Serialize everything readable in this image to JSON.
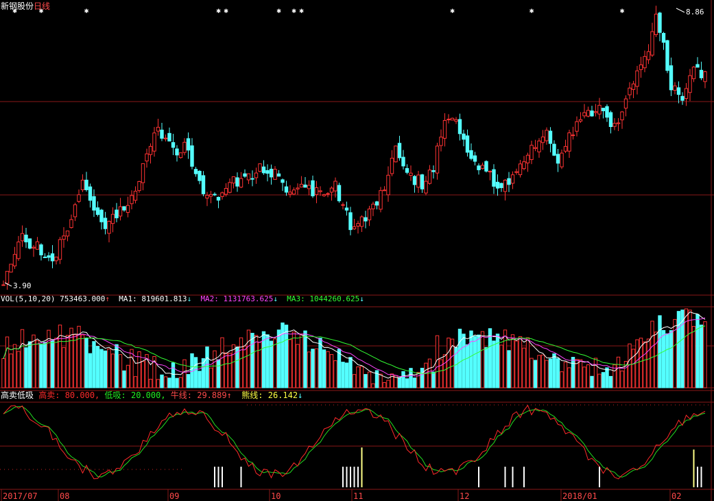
{
  "title": {
    "stock": "新钢股份",
    "period": "日线"
  },
  "colors": {
    "up": "#ff3333",
    "down": "#54ffff",
    "grid": "#8a1818",
    "ma1": "#ffffff",
    "ma2": "#ff44ff",
    "ma3": "#33ff33",
    "gm": "#ff2a2a",
    "dx": "#22ee22",
    "bull": "#ff4a4a",
    "bear": "#ffff44"
  },
  "price_panel": {
    "high_label": "8.86",
    "low_label": "3.90",
    "star_glyph": "✱"
  },
  "vol_header": {
    "name": "VOL(5,10,20)",
    "value": "753463.000",
    "value_arrow": "↑",
    "ma1": "MA1: 819601.813",
    "ma1_arrow": "↓",
    "ma2": "MA2: 1131763.625",
    "ma2_arrow": "↓",
    "ma3": "MA3: 1044260.625",
    "ma3_arrow": "↓"
  },
  "ind_header": {
    "name": "高卖低吸",
    "gm": "高卖: 80.000,",
    "dx": "低吸: 20.000,",
    "bull": "牛线: 29.889",
    "bull_arrow": "↑",
    "bear": "熊线: 26.142",
    "bear_arrow": "↓"
  },
  "x_labels": [
    "2017/07",
    "08",
    "09",
    "10",
    "11",
    "12",
    "2018/01",
    "02"
  ],
  "chart_data": {
    "type": "candlestick",
    "price_range": [
      3.9,
      8.86
    ],
    "high": 8.86,
    "low": 3.9,
    "price_start": 4.05,
    "price_end": 7.95,
    "volume_ma": {
      "MA1": 819601.813,
      "MA2": 1131763.625,
      "MA3": 1044260.625,
      "last": 753463.0
    },
    "indicator": {
      "高卖": 80.0,
      "低吸": 20.0,
      "牛线": 29.889,
      "熊线": 26.142
    },
    "months": [
      "2017/07",
      "08",
      "09",
      "10",
      "11",
      "12",
      "2018/01",
      "02"
    ],
    "price_path": [
      [
        0,
        3.95
      ],
      [
        5,
        4.75
      ],
      [
        9,
        4.6
      ],
      [
        13,
        4.35
      ],
      [
        17,
        4.95
      ],
      [
        21,
        5.75
      ],
      [
        24,
        5.3
      ],
      [
        27,
        4.9
      ],
      [
        30,
        5.2
      ],
      [
        35,
        5.55
      ],
      [
        38,
        6.25
      ],
      [
        41,
        6.7
      ],
      [
        45,
        6.3
      ],
      [
        48,
        6.4
      ],
      [
        53,
        5.6
      ],
      [
        57,
        5.45
      ],
      [
        60,
        5.75
      ],
      [
        64,
        5.85
      ],
      [
        68,
        6.0
      ],
      [
        72,
        5.9
      ],
      [
        76,
        5.55
      ],
      [
        80,
        5.7
      ],
      [
        84,
        5.55
      ],
      [
        88,
        5.7
      ],
      [
        92,
        5.0
      ],
      [
        96,
        5.1
      ],
      [
        101,
        5.7
      ],
      [
        104,
        6.3
      ],
      [
        107,
        5.9
      ],
      [
        111,
        5.75
      ],
      [
        114,
        6.0
      ],
      [
        117,
        6.95
      ],
      [
        120,
        6.8
      ],
      [
        124,
        6.1
      ],
      [
        128,
        5.95
      ],
      [
        132,
        5.65
      ],
      [
        136,
        5.95
      ],
      [
        140,
        6.45
      ],
      [
        144,
        6.6
      ],
      [
        147,
        6.05
      ],
      [
        151,
        6.7
      ],
      [
        155,
        7.0
      ],
      [
        159,
        7.05
      ],
      [
        162,
        6.7
      ],
      [
        165,
        7.3
      ],
      [
        168,
        7.7
      ],
      [
        171,
        8.15
      ],
      [
        173,
        8.7
      ],
      [
        175,
        8.2
      ],
      [
        177,
        7.5
      ],
      [
        180,
        7.3
      ],
      [
        183,
        7.85
      ],
      [
        186,
        7.65
      ]
    ],
    "stars_x": [
      3,
      10,
      22,
      57,
      59,
      73,
      77,
      79,
      119,
      140,
      164,
      226
    ]
  }
}
